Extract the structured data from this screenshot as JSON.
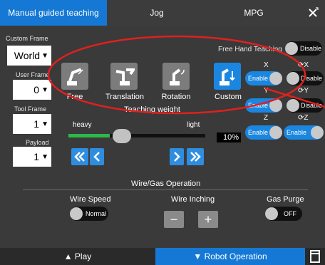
{
  "tabs": {
    "manual": "Manual guided teaching",
    "jog": "Jog",
    "mpg": "MPG"
  },
  "left": {
    "custom_frame_label": "Custom Frame",
    "custom_frame_value": "World",
    "user_frame_label": "User Frame",
    "user_frame_value": "0",
    "tool_frame_label": "Tool Frame",
    "tool_frame_value": "1",
    "payload_label": "Payload",
    "payload_value": "1"
  },
  "modes": {
    "free": "Free",
    "translation": "Translation",
    "rotation": "Rotation",
    "custom": "Custom"
  },
  "freehand": {
    "label": "Free Hand Teaching",
    "toggle": "Disable"
  },
  "axes": {
    "x": "X",
    "rx": "⟳X",
    "y": "Y",
    "ry": "⟳Y",
    "z": "Z",
    "rz": "⟳Z",
    "enable": "Enable",
    "disable": "Disable"
  },
  "weight": {
    "title": "Teaching weight",
    "heavy": "heavy",
    "light": "light",
    "percent": "10%",
    "level": 0.1
  },
  "wire": {
    "section": "Wire/Gas Operation",
    "speed_label": "Wire Speed",
    "speed_toggle": "Normal",
    "inching_label": "Wire Inching",
    "minus": "−",
    "plus": "+",
    "gas_label": "Gas Purge",
    "gas_toggle": "OFF"
  },
  "bottom": {
    "play": "▲ Play",
    "robot_operation": "▼ Robot Operation"
  },
  "colors": {
    "accent": "#1a86e0",
    "annotation": "#e0201e",
    "slider_fill": "#2db84a"
  }
}
